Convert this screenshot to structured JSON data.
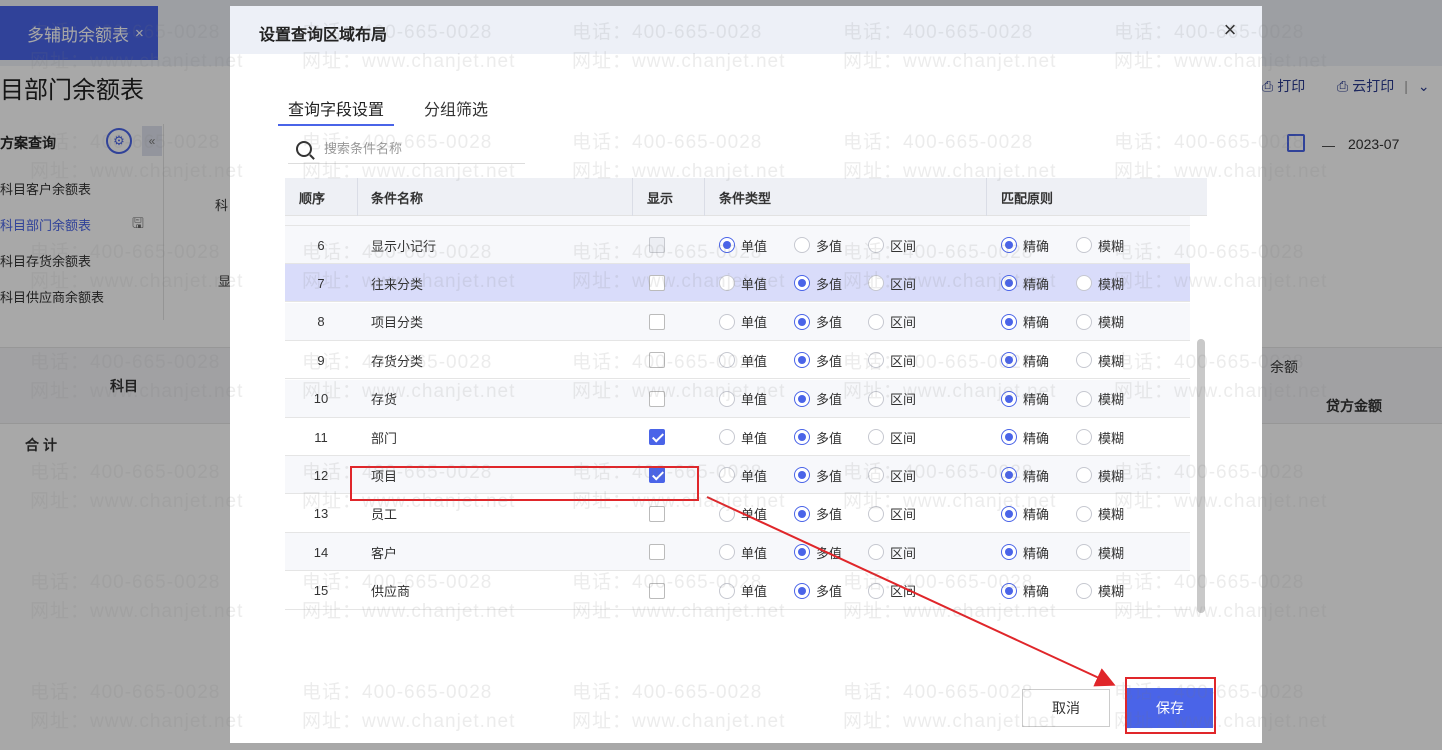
{
  "background": {
    "tab_label": "多辅助余额表",
    "tab_close": "×",
    "page_title": "目部门余额表",
    "toolbar": {
      "print": "打印",
      "cloud_print": "云打印"
    },
    "side_head": "方案查询",
    "side_items": [
      "科目客户余额表",
      "科目部门余额表",
      "科目存货余额表",
      "科目供应商余额表"
    ],
    "filter_label_1": "科",
    "filter_label_2": "显",
    "date_value": "2023-07",
    "grid_col_1": "科目",
    "grid_col_2": "贷方金额",
    "grid_col_3": "余额",
    "grid_total": "合计"
  },
  "dialog": {
    "title": "设置查询区域布局",
    "close_icon": "close-icon",
    "tabs": [
      {
        "label": "查询字段设置",
        "active": true
      },
      {
        "label": "分组筛选",
        "active": false
      }
    ],
    "search": {
      "placeholder": "搜索条件名称",
      "value": ""
    },
    "table": {
      "headers": [
        "顺序",
        "条件名称",
        "显示",
        "条件类型",
        "匹配原则"
      ],
      "type_options": [
        "单值",
        "多值",
        "区间"
      ],
      "match_options": [
        "精确",
        "模糊"
      ],
      "rows": [
        {
          "seq": "6",
          "name": "显示小记行",
          "show": false,
          "show_disabled": true,
          "type": "单值",
          "match": "精确"
        },
        {
          "seq": "7",
          "name": "往来分类",
          "show": false,
          "type": "多值",
          "match": "精确",
          "selected": true
        },
        {
          "seq": "8",
          "name": "项目分类",
          "show": false,
          "type": "多值",
          "match": "精确"
        },
        {
          "seq": "9",
          "name": "存货分类",
          "show": false,
          "type": "多值",
          "match": "精确"
        },
        {
          "seq": "10",
          "name": "存货",
          "show": false,
          "type": "多值",
          "match": "精确"
        },
        {
          "seq": "11",
          "name": "部门",
          "show": true,
          "type": "多值",
          "match": "精确"
        },
        {
          "seq": "12",
          "name": "项目",
          "show": true,
          "type": "多值",
          "match": "精确"
        },
        {
          "seq": "13",
          "name": "员工",
          "show": false,
          "type": "多值",
          "match": "精确"
        },
        {
          "seq": "14",
          "name": "客户",
          "show": false,
          "type": "多值",
          "match": "精确"
        },
        {
          "seq": "15",
          "name": "供应商",
          "show": false,
          "type": "多值",
          "match": "精确"
        }
      ]
    },
    "buttons": {
      "cancel": "取消",
      "save": "保存"
    }
  },
  "watermark": {
    "phone": "电话：400-665-0028",
    "site": "网址：www.chanjet.net"
  },
  "colors": {
    "accent": "#4a64e8",
    "annotation": "#e0262a",
    "selected_row": "#d9dcfa"
  }
}
